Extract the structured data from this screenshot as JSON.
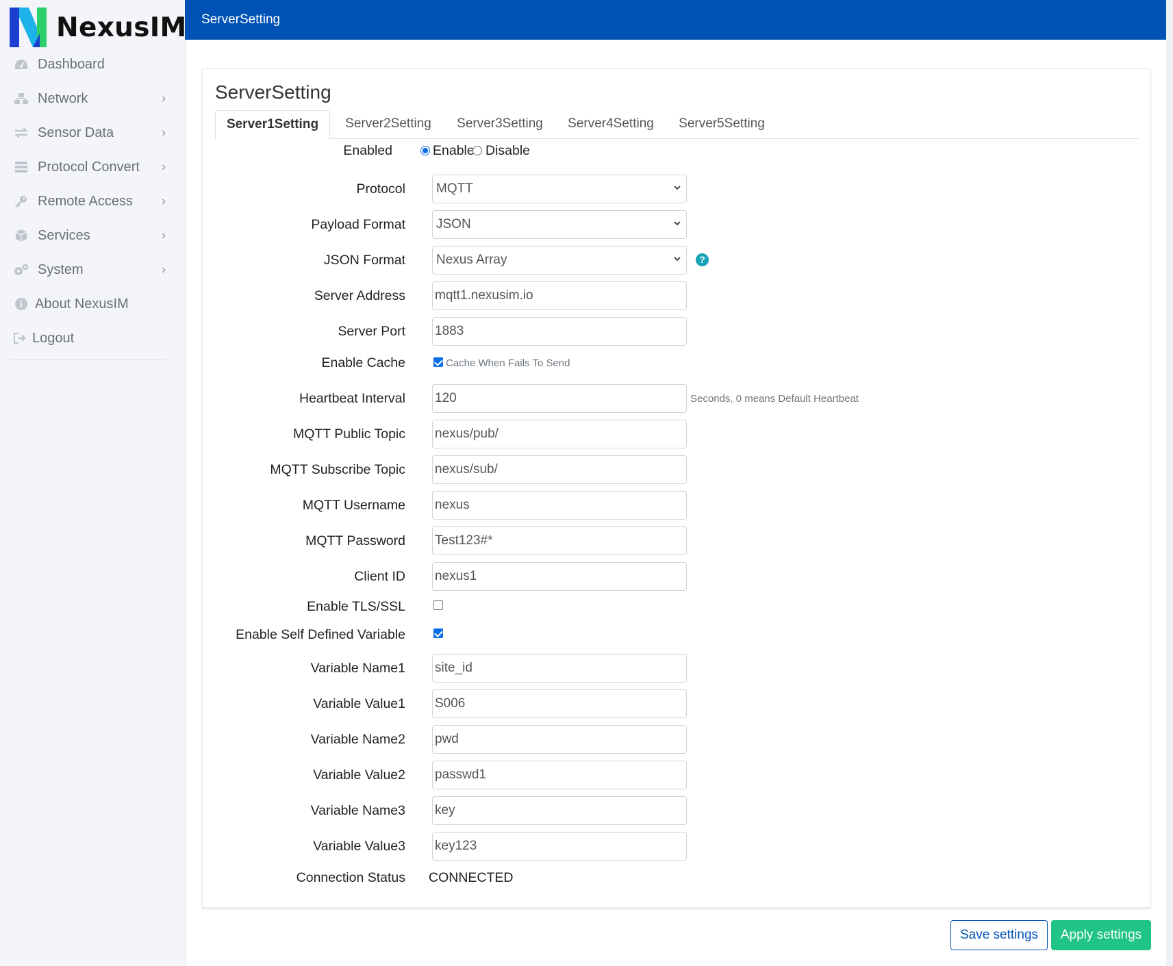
{
  "brand": {
    "name": "NexusIM",
    "logo_colors": [
      "#1a3fd1",
      "#1db3e8",
      "#2bd06a"
    ]
  },
  "sidebar": {
    "items": [
      {
        "label": "Dashboard",
        "icon": "dashboard-icon",
        "has_submenu": false
      },
      {
        "label": "Network",
        "icon": "network-icon",
        "has_submenu": true
      },
      {
        "label": "Sensor Data",
        "icon": "exchange-icon",
        "has_submenu": true
      },
      {
        "label": "Protocol Convert",
        "icon": "server-icon",
        "has_submenu": true
      },
      {
        "label": "Remote Access",
        "icon": "key-icon",
        "has_submenu": true
      },
      {
        "label": "Services",
        "icon": "cube-icon",
        "has_submenu": true
      },
      {
        "label": "System",
        "icon": "gears-icon",
        "has_submenu": true
      },
      {
        "label": "About NexusIM",
        "icon": "info-icon",
        "has_submenu": false
      },
      {
        "label": "Logout",
        "icon": "logout-icon",
        "has_submenu": false
      }
    ]
  },
  "header": {
    "title": "ServerSetting"
  },
  "card": {
    "title": "ServerSetting",
    "tabs": [
      {
        "label": "Server1Setting",
        "active": true
      },
      {
        "label": "Server2Setting",
        "active": false
      },
      {
        "label": "Server3Setting",
        "active": false
      },
      {
        "label": "Server4Setting",
        "active": false
      },
      {
        "label": "Server5Setting",
        "active": false
      }
    ]
  },
  "form": {
    "enabled": {
      "label": "Enabled",
      "enable_label": "Enable",
      "disable_label": "Disable",
      "value": "Enable"
    },
    "protocol": {
      "label": "Protocol",
      "value": "MQTT"
    },
    "payload_format": {
      "label": "Payload Format",
      "value": "JSON"
    },
    "json_format": {
      "label": "JSON Format",
      "value": "Nexus Array",
      "help": "?"
    },
    "server_address": {
      "label": "Server Address",
      "value": "mqtt1.nexusim.io"
    },
    "server_port": {
      "label": "Server Port",
      "value": "1883"
    },
    "enable_cache": {
      "label": "Enable Cache",
      "checked": true,
      "hint": "Cache When Fails To Send"
    },
    "heartbeat_interval": {
      "label": "Heartbeat Interval",
      "value": "120",
      "hint": "Seconds, 0 means Default Heartbeat"
    },
    "mqtt_public_topic": {
      "label": "MQTT Public Topic",
      "value": "nexus/pub/"
    },
    "mqtt_subscribe_topic": {
      "label": "MQTT Subscribe Topic",
      "value": "nexus/sub/"
    },
    "mqtt_username": {
      "label": "MQTT Username",
      "value": "nexus"
    },
    "mqtt_password": {
      "label": "MQTT Password",
      "value": "Test123#*"
    },
    "client_id": {
      "label": "Client ID",
      "value": "nexus1"
    },
    "enable_tls": {
      "label": "Enable TLS/SSL",
      "checked": false
    },
    "enable_self_defined": {
      "label": "Enable Self Defined Variable",
      "checked": true
    },
    "variable_name1": {
      "label": "Variable Name1",
      "value": "site_id"
    },
    "variable_value1": {
      "label": "Variable Value1",
      "value": "S006"
    },
    "variable_name2": {
      "label": "Variable Name2",
      "value": "pwd"
    },
    "variable_value2": {
      "label": "Variable Value2",
      "value": "passwd1"
    },
    "variable_name3": {
      "label": "Variable Name3",
      "value": "key"
    },
    "variable_value3": {
      "label": "Variable Value3",
      "value": "key123"
    },
    "connection_status": {
      "label": "Connection Status",
      "value": "CONNECTED"
    }
  },
  "actions": {
    "save_label": "Save settings",
    "apply_label": "Apply settings"
  },
  "colors": {
    "header": "#0052b4",
    "apply": "#1fc486",
    "accent": "#0b6ee8"
  }
}
